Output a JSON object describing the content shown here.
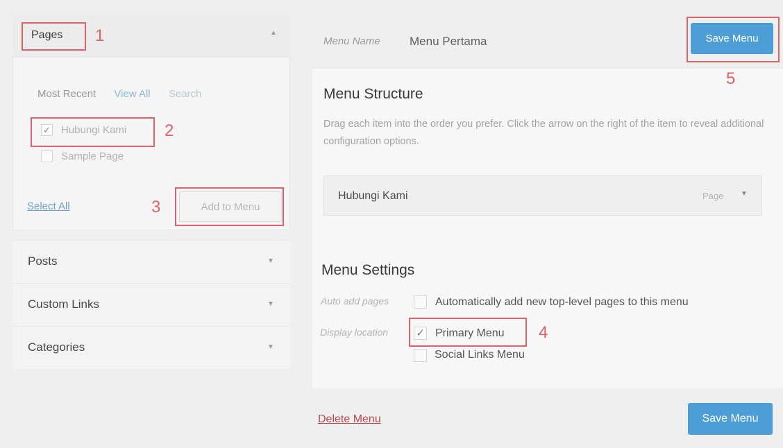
{
  "left": {
    "pages": {
      "title": "Pages",
      "tabs": [
        "Most Recent",
        "View All",
        "Search"
      ],
      "items": [
        {
          "label": "Hubungi Kami",
          "checked": true
        },
        {
          "label": "Sample Page",
          "checked": false
        }
      ],
      "select_all": "Select All",
      "add_button": "Add to Menu"
    },
    "accordion": [
      "Posts",
      "Custom Links",
      "Categories"
    ]
  },
  "menu": {
    "name_label": "Menu Name",
    "name_value": "Menu Pertama",
    "save_label": "Save Menu",
    "structure_heading": "Menu Structure",
    "structure_desc": "Drag each item into the order you prefer. Click the arrow on the right of the item to reveal additional configuration options.",
    "item": {
      "title": "Hubungi Kami",
      "type": "Page"
    },
    "settings_heading": "Menu Settings",
    "auto_add_label": "Auto add pages",
    "auto_add_text": "Automatically add new top-level pages to this menu",
    "display_location_label": "Display location",
    "locations": [
      {
        "label": "Primary Menu",
        "checked": true
      },
      {
        "label": "Social Links Menu",
        "checked": false
      }
    ],
    "delete_label": "Delete Menu"
  },
  "annotations": [
    "1",
    "2",
    "3",
    "4",
    "5"
  ],
  "icons": {
    "checkmark": "check-icon",
    "arrow_down": "chevron-down-icon",
    "arrow_up": "chevron-up-icon"
  },
  "colors": {
    "accent": "#4d9ed6",
    "annotation": "#d9636b",
    "delete": "#c0464e"
  }
}
